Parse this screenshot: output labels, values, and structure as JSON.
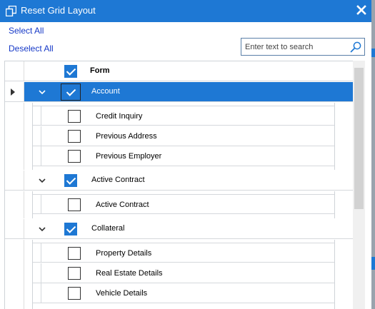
{
  "window": {
    "title": "Reset Grid Layout"
  },
  "links": {
    "select_all": "Select All",
    "deselect_all": "Deselect All"
  },
  "search": {
    "placeholder": "Enter text to search",
    "value": ""
  },
  "grid": {
    "header": {
      "column": "Form",
      "checked": true
    },
    "groups": [
      {
        "name": "Account",
        "checked": true,
        "selected": true,
        "expanded": true,
        "children": [
          {
            "name": "Credit Inquiry",
            "checked": false
          },
          {
            "name": "Previous Address",
            "checked": false
          },
          {
            "name": "Previous Employer",
            "checked": false
          }
        ]
      },
      {
        "name": "Active Contract",
        "checked": true,
        "selected": false,
        "expanded": true,
        "children": [
          {
            "name": "Active Contract",
            "checked": false
          }
        ]
      },
      {
        "name": "Collateral",
        "checked": true,
        "selected": false,
        "expanded": true,
        "children": [
          {
            "name": "Property Details",
            "checked": false
          },
          {
            "name": "Real Estate Details",
            "checked": false
          },
          {
            "name": "Vehicle Details",
            "checked": false
          }
        ]
      }
    ]
  },
  "colors": {
    "accent": "#1e78d4",
    "link": "#1538c7"
  }
}
